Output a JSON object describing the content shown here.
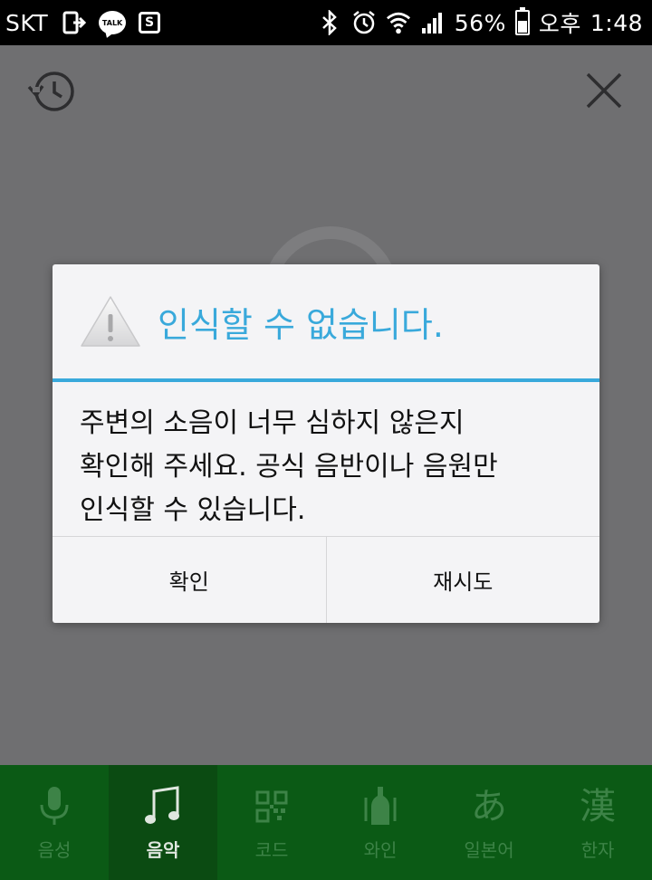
{
  "status_bar": {
    "carrier": "SKT",
    "talk_label": "TALK",
    "s_label": "S",
    "battery_percent": "56%",
    "battery_level": 0.56,
    "ampm": "오후",
    "time": "1:48"
  },
  "dialog": {
    "title": "인식할 수 없습니다.",
    "message_lines": [
      "주변의 소음이 너무 심하지 않은지",
      "확인해 주세요. 공식 음반이나 음원만",
      "인식할 수 있습니다."
    ],
    "ok_label": "확인",
    "retry_label": "재시도"
  },
  "tabs": [
    {
      "label": "음성",
      "icon": "microphone-icon",
      "active": false
    },
    {
      "label": "음악",
      "icon": "music-note-icon",
      "active": true
    },
    {
      "label": "코드",
      "icon": "qr-code-icon",
      "active": false
    },
    {
      "label": "와인",
      "icon": "wine-bottle-icon",
      "active": false
    },
    {
      "label": "일본어",
      "icon": "hiragana-icon",
      "glyph": "あ",
      "active": false
    },
    {
      "label": "한자",
      "icon": "hanja-icon",
      "glyph": "漢",
      "active": false
    }
  ],
  "colors": {
    "accent": "#39a9db",
    "tabbar_bg": "#0b5a15",
    "tab_active_bg": "#0b4b12",
    "overlay_bg": "#6f6f71"
  }
}
